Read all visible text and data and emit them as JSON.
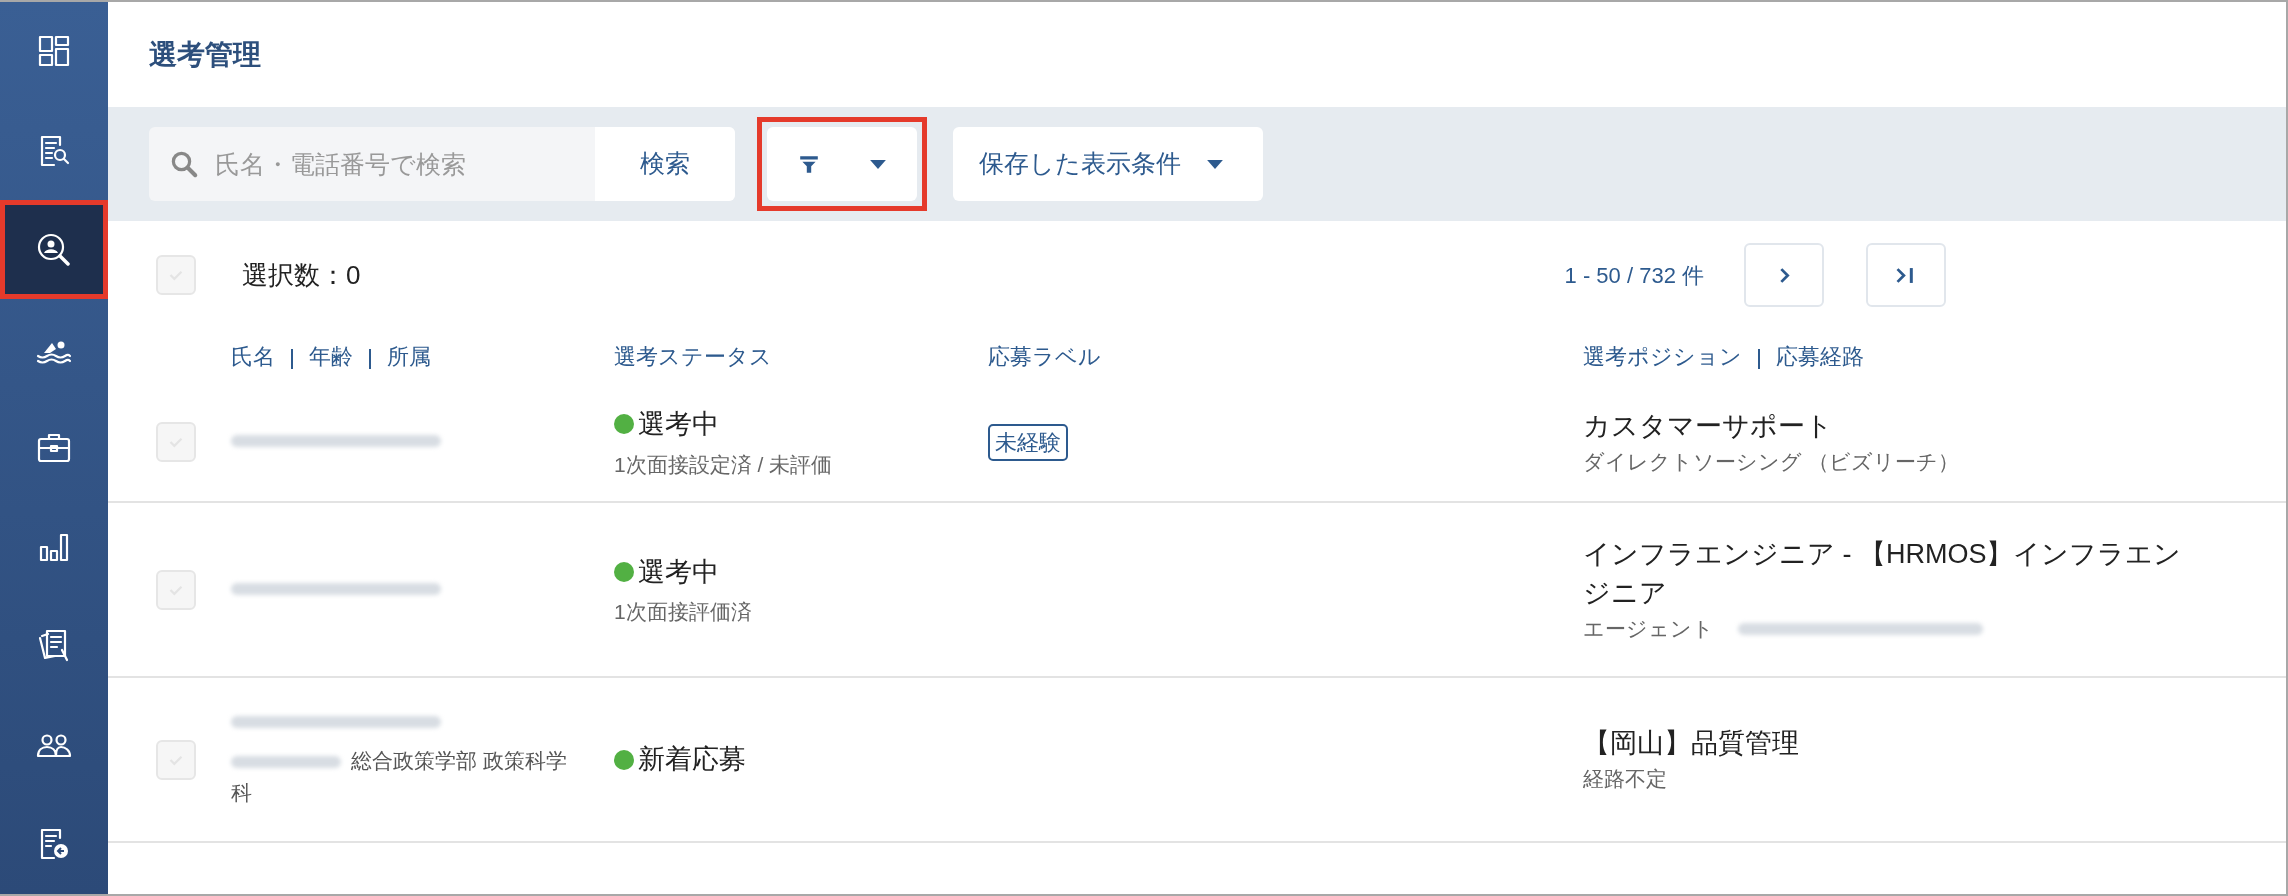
{
  "sidebar": {
    "items": [
      {
        "selected": false,
        "highlighted": false
      },
      {
        "selected": false,
        "highlighted": false
      },
      {
        "selected": true,
        "highlighted": true
      },
      {
        "selected": false,
        "highlighted": false
      },
      {
        "selected": false,
        "highlighted": false
      },
      {
        "selected": false,
        "highlighted": false
      },
      {
        "selected": false,
        "highlighted": false
      },
      {
        "selected": false,
        "highlighted": false
      },
      {
        "selected": false,
        "highlighted": false
      }
    ]
  },
  "page_title": "選考管理",
  "toolbar": {
    "search": {
      "placeholder": "氏名・電話番号で検索",
      "button": "検索"
    },
    "filter_button": {
      "highlighted": true
    },
    "saved_views": {
      "label": "保存した表示条件"
    }
  },
  "selection": {
    "checked": false,
    "label": "選択数：0"
  },
  "pagination": {
    "range": "1 - 50 / 732 件"
  },
  "columns": [
    {
      "labels": [
        "氏名",
        "年齢",
        "所属"
      ]
    },
    {
      "labels": [
        "選考ステータス"
      ]
    },
    {
      "labels": [
        "応募ラベル"
      ]
    },
    {
      "labels": [
        "選考ポジション",
        "応募経路"
      ]
    }
  ],
  "rows": [
    {
      "checked": false,
      "affiliation": null,
      "status": "選考中",
      "color": "#52b043",
      "status_detail": "1次面接設定済 / 未評価",
      "label": "未経験",
      "position": "カスタマーサポート",
      "route": "ダイレクトソーシング （ビズリーチ）",
      "route_redacted": false
    },
    {
      "checked": false,
      "affiliation": null,
      "status": "選考中",
      "color": "#52b043",
      "status_detail": "1次面接評価済",
      "label": null,
      "position": "インフラエンジニア - 【HRMOS】インフラエンジニア",
      "route": "エージェント",
      "route_redacted": true
    },
    {
      "checked": false,
      "affiliation": "総合政策学部 政策科学科",
      "status": "新着応募",
      "color": "#52b043",
      "status_detail": null,
      "label": null,
      "position": "【岡山】品質管理",
      "route": "経路不定",
      "route_redacted": false
    }
  ]
}
